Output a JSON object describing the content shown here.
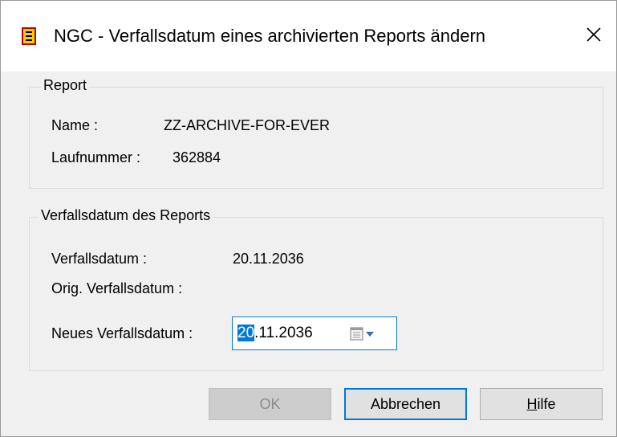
{
  "window": {
    "title": "NGC - Verfallsdatum eines archivierten Reports ändern",
    "app_icon": "document-report-icon",
    "close_symbol": "✕"
  },
  "report_group": {
    "legend": "Report",
    "name_label": "Name :",
    "name_value": "ZZ-ARCHIVE-FOR-EVER",
    "run_label": "Laufnummer :",
    "run_value": "362884"
  },
  "expiry_group": {
    "legend": "Verfallsdatum des Reports",
    "current_label": "Verfallsdatum :",
    "current_value": "20.11.2036",
    "original_label": "Orig. Verfallsdatum :",
    "original_value": "",
    "new_label": "Neues Verfallsdatum :",
    "new_value_selected": "20",
    "new_value_rest": ".11.2036",
    "calendar_icon": "calendar-icon",
    "dropdown_icon": "chevron-down-icon"
  },
  "buttons": {
    "ok": "OK",
    "cancel": "Abbrechen",
    "help_mnemonic": "H",
    "help_rest": "ilfe"
  },
  "colors": {
    "accent": "#0078d7",
    "icon_fill": "#f5d000",
    "icon_border": "#c00000"
  }
}
